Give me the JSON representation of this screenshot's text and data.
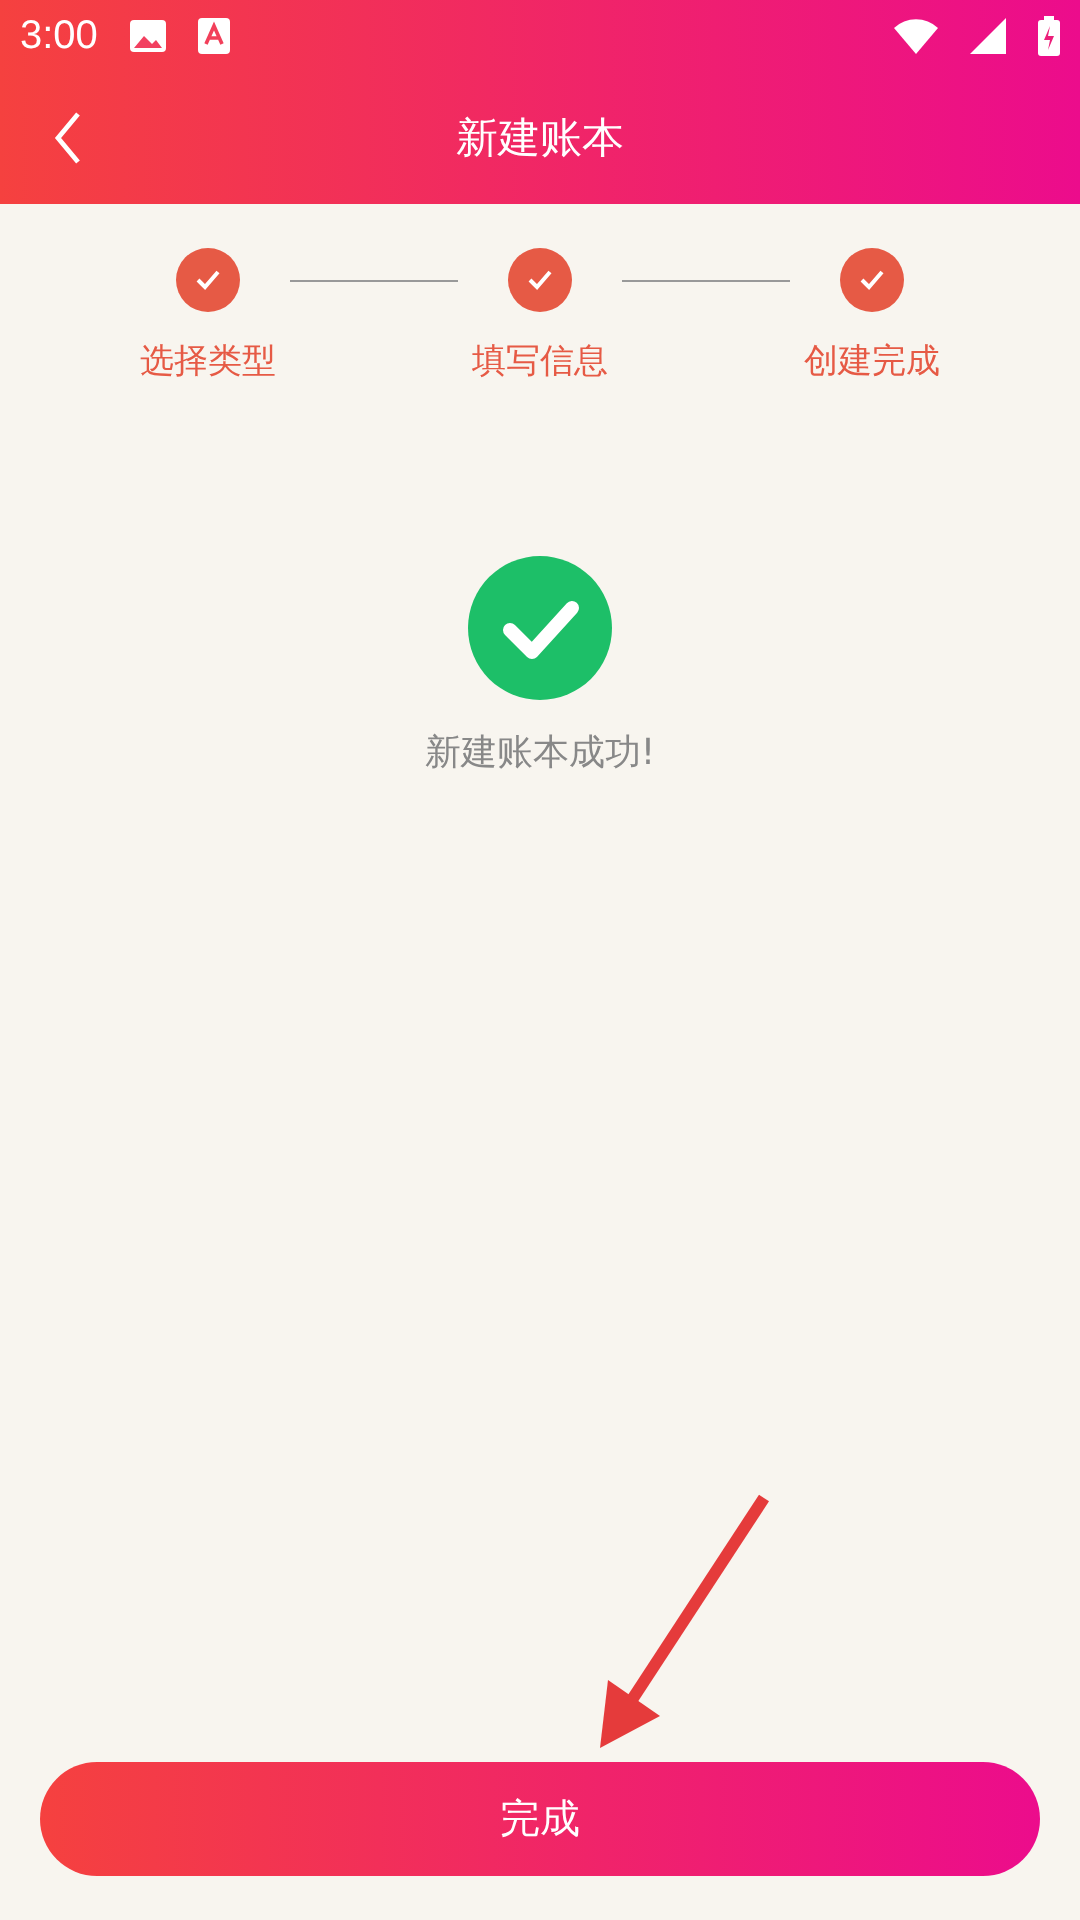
{
  "status_bar": {
    "time": "3:00"
  },
  "header": {
    "title": "新建账本"
  },
  "steps": [
    {
      "label": "选择类型",
      "done": true
    },
    {
      "label": "填写信息",
      "done": true
    },
    {
      "label": "创建完成",
      "done": true
    }
  ],
  "result": {
    "message": "新建账本成功!"
  },
  "button": {
    "label": "完成"
  }
}
